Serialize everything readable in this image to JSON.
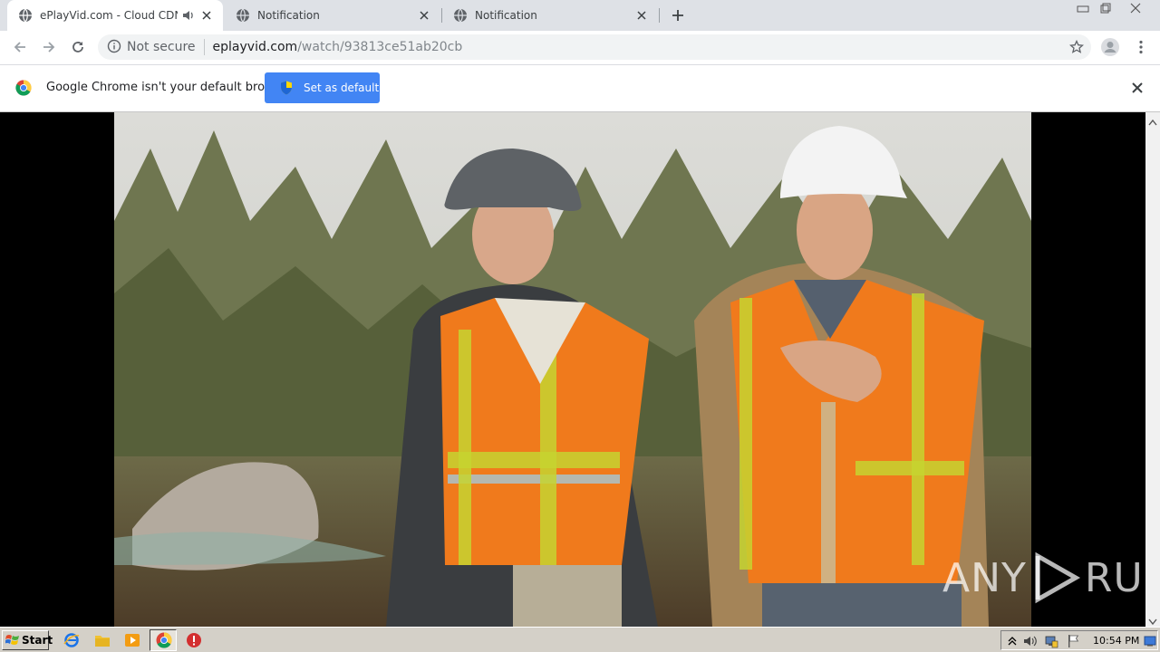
{
  "tabs": [
    {
      "title": "ePlayVid.com - Cloud CDN",
      "active": true,
      "audio": true
    },
    {
      "title": "Notification",
      "active": false
    },
    {
      "title": "Notification",
      "active": false
    }
  ],
  "toolbar": {
    "security_label": "Not secure",
    "url_host": "eplayvid.com",
    "url_path": "/watch/93813ce51ab20cb"
  },
  "infobar": {
    "message": "Google Chrome isn't your default browser",
    "button_label": "Set as default"
  },
  "video": {
    "description_icon": "video-frame"
  },
  "watermark": {
    "left": "ANY",
    "right": "RUN"
  },
  "taskbar": {
    "start_label": "Start",
    "clock": "10:54 PM"
  },
  "colors": {
    "accent": "#4285f4",
    "tabstrip": "#dee1e6",
    "taskbar": "#d4d0c8"
  }
}
